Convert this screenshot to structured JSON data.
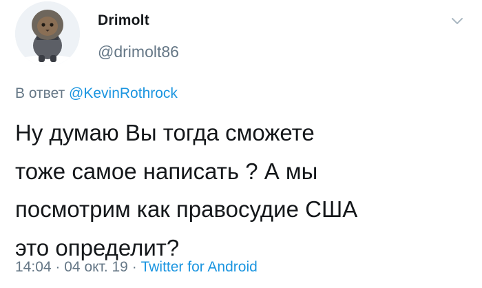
{
  "tweet": {
    "author": {
      "display_name": "Drimolt",
      "handle": "@drimolt86",
      "avatar_icon": "cat-in-hood-avatar"
    },
    "menu_icon": "chevron-down-icon",
    "reply_prefix": "В ответ",
    "reply_mention": "@KevinRothrock",
    "text": "Ну думаю Вы тогда сможете\nтоже самое написать ? А мы\nпосмотрим как правосудие США\nэто определит?",
    "time": "14:04",
    "separator": "·",
    "date": "04 окт. 19",
    "source": "Twitter for Android"
  },
  "colors": {
    "text": "#14171a",
    "secondary": "#657786",
    "link": "#1b95e0"
  }
}
